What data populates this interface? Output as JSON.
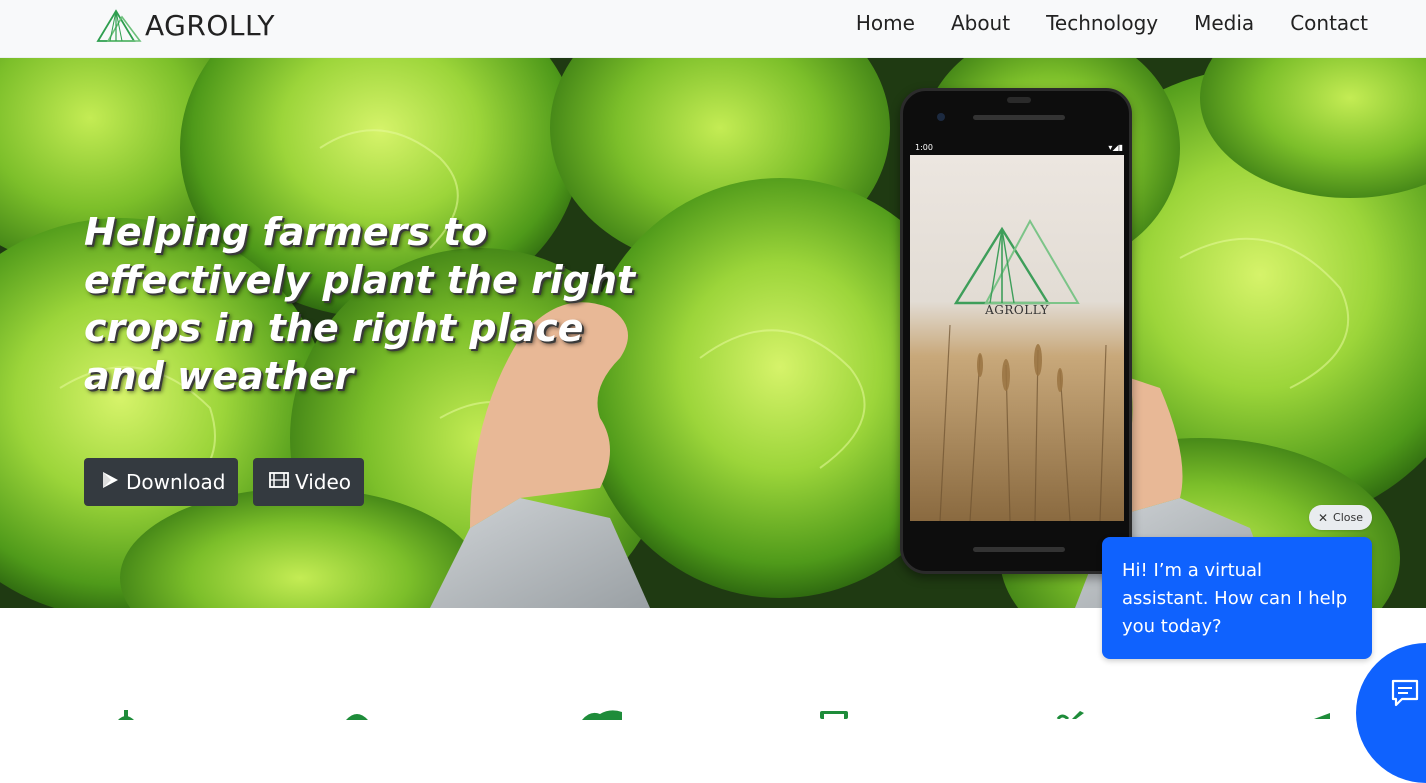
{
  "brand": {
    "name": "AGROLLY",
    "logo_icon": "triangle-mountain-logo",
    "color": "#2e9e4f"
  },
  "nav": {
    "items": [
      "Home",
      "About",
      "Technology",
      "Media",
      "Contact"
    ]
  },
  "hero": {
    "headline": "Helping farmers to effectively plant the right crops in the right place and weather",
    "buttons": {
      "download": "Download",
      "video": "Video"
    },
    "phone": {
      "time": "1:00",
      "app_name": "AGROLLY"
    }
  },
  "chat": {
    "close_label": "Close",
    "message": "Hi! I’m a virtual assistant. How can I help you today?",
    "accent": "#0f62fe"
  },
  "features": {
    "icons": [
      "dollar-icon",
      "leaf-icon",
      "cloud-icon",
      "phone-icon",
      "wifi-icon",
      "arrow-icon"
    ],
    "color": "#1e8c3a"
  }
}
